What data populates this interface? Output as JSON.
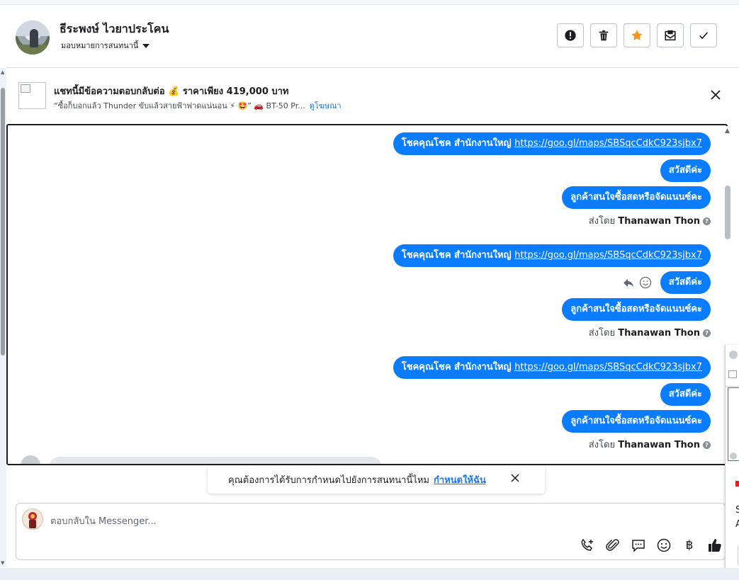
{
  "header": {
    "contact_name": "ธีระพงษ์ ไวยาประโคน",
    "assign_label": "มอบหมายการสนทนานี้",
    "actions": [
      {
        "name": "spam-button",
        "icon": "alert-icon"
      },
      {
        "name": "delete-button",
        "icon": "trash-icon"
      },
      {
        "name": "star-button",
        "icon": "star-icon"
      },
      {
        "name": "mark-unread-button",
        "icon": "envelope-icon"
      },
      {
        "name": "done-button",
        "icon": "check-icon"
      }
    ]
  },
  "ad": {
    "title": "แชทนี้มีข้อความตอบกลับต่อ 💰 ราคาเพียง 419,000 บาท",
    "subtitle": "“ซื้อก็บอกแล้ว Thunder ขับแล้วสายฟ้าฟาดแน่นอน ⚡ 🤩” 🚗 BT-50 Pr...",
    "link": "ดูโฆษณา"
  },
  "messages": {
    "groups": [
      {
        "bubbles": [
          {
            "prefix": "โชคคุณโชค สำนักงานใหญ่ ",
            "link": "https://goo.gl/maps/SBSqcCdkC923sjbx7"
          },
          {
            "text": "สวัสดีค่ะ"
          },
          {
            "text": "ลูกค้าสนใจซื้อสดหรือจัดแนนซ์คะ"
          }
        ],
        "sent_by_prefix": "ส่งโดย",
        "sent_by_name": "Thanawan Thon"
      },
      {
        "bubbles": [
          {
            "prefix": "โชคคุณโชค สำนักงานใหญ่ ",
            "link": "https://goo.gl/maps/SBSqcCdkC923sjbx7"
          },
          {
            "text": "สวัสดีค่ะ"
          },
          {
            "text": "ลูกค้าสนใจซื้อสดหรือจัดแนนซ์คะ"
          }
        ],
        "sent_by_prefix": "ส่งโดย",
        "sent_by_name": "Thanawan Thon"
      },
      {
        "bubbles": [
          {
            "prefix": "โชคคุณโชค สำนักงานใหญ่ ",
            "link": "https://goo.gl/maps/SBSqcCdkC923sjbx7"
          },
          {
            "text": "สวัสดีค่ะ"
          },
          {
            "text": "ลูกค้าสนใจซื้อสดหรือจัดแนนซ์คะ"
          }
        ],
        "sent_by_prefix": "ส่งโดย",
        "sent_by_name": "Thanawan Thon"
      }
    ],
    "help_glyph": "?"
  },
  "suggestion": {
    "text": "คุณต้องการได้รับการกำหนดไปยังการสนทนานี้ไหม",
    "link": "กำหนดให้ฉัน"
  },
  "composer": {
    "placeholder": "ตอบกลับใน Messenger...",
    "baht_symbol": "฿",
    "tools": [
      "call-icon",
      "attach-icon",
      "saved-reply-icon",
      "emoji-icon",
      "baht-icon",
      "like-icon"
    ]
  },
  "side_panel": {
    "t1": "S",
    "t2": "A"
  },
  "colors": {
    "bubble": "#0a7cff",
    "link": "#1877f2",
    "star": "#f7931e"
  }
}
